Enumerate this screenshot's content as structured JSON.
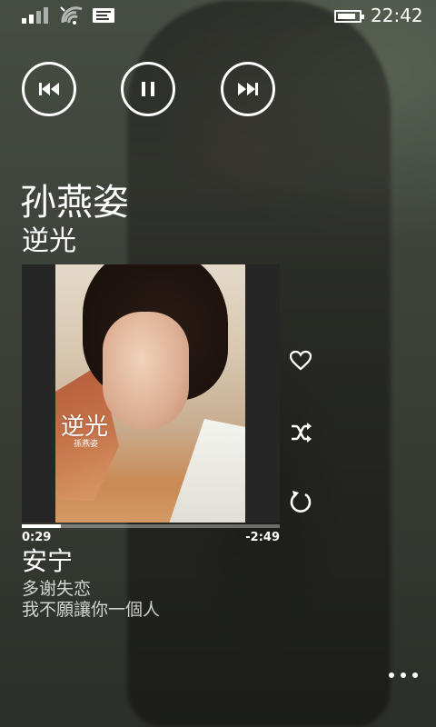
{
  "status_bar": {
    "signal_bars_on": 2,
    "signal_bars_total": 4,
    "battery_level": 0.85,
    "time": "22:42"
  },
  "controls": {
    "previous": "previous-icon",
    "play_pause": "pause-icon",
    "next": "next-icon"
  },
  "now_playing": {
    "artist": "孙燕姿",
    "album": "逆光",
    "album_art_text": "逆光",
    "album_art_artist": "孫燕姿",
    "elapsed": "0:29",
    "remaining": "-2:49",
    "progress": 0.15,
    "track": "安宁"
  },
  "up_next": [
    "多谢失恋",
    "我不願讓你一個人"
  ],
  "side_actions": [
    "heart-icon",
    "shuffle-icon",
    "repeat-icon"
  ],
  "colors": {
    "foreground": "#ffffff",
    "art_frame": "#262626"
  }
}
